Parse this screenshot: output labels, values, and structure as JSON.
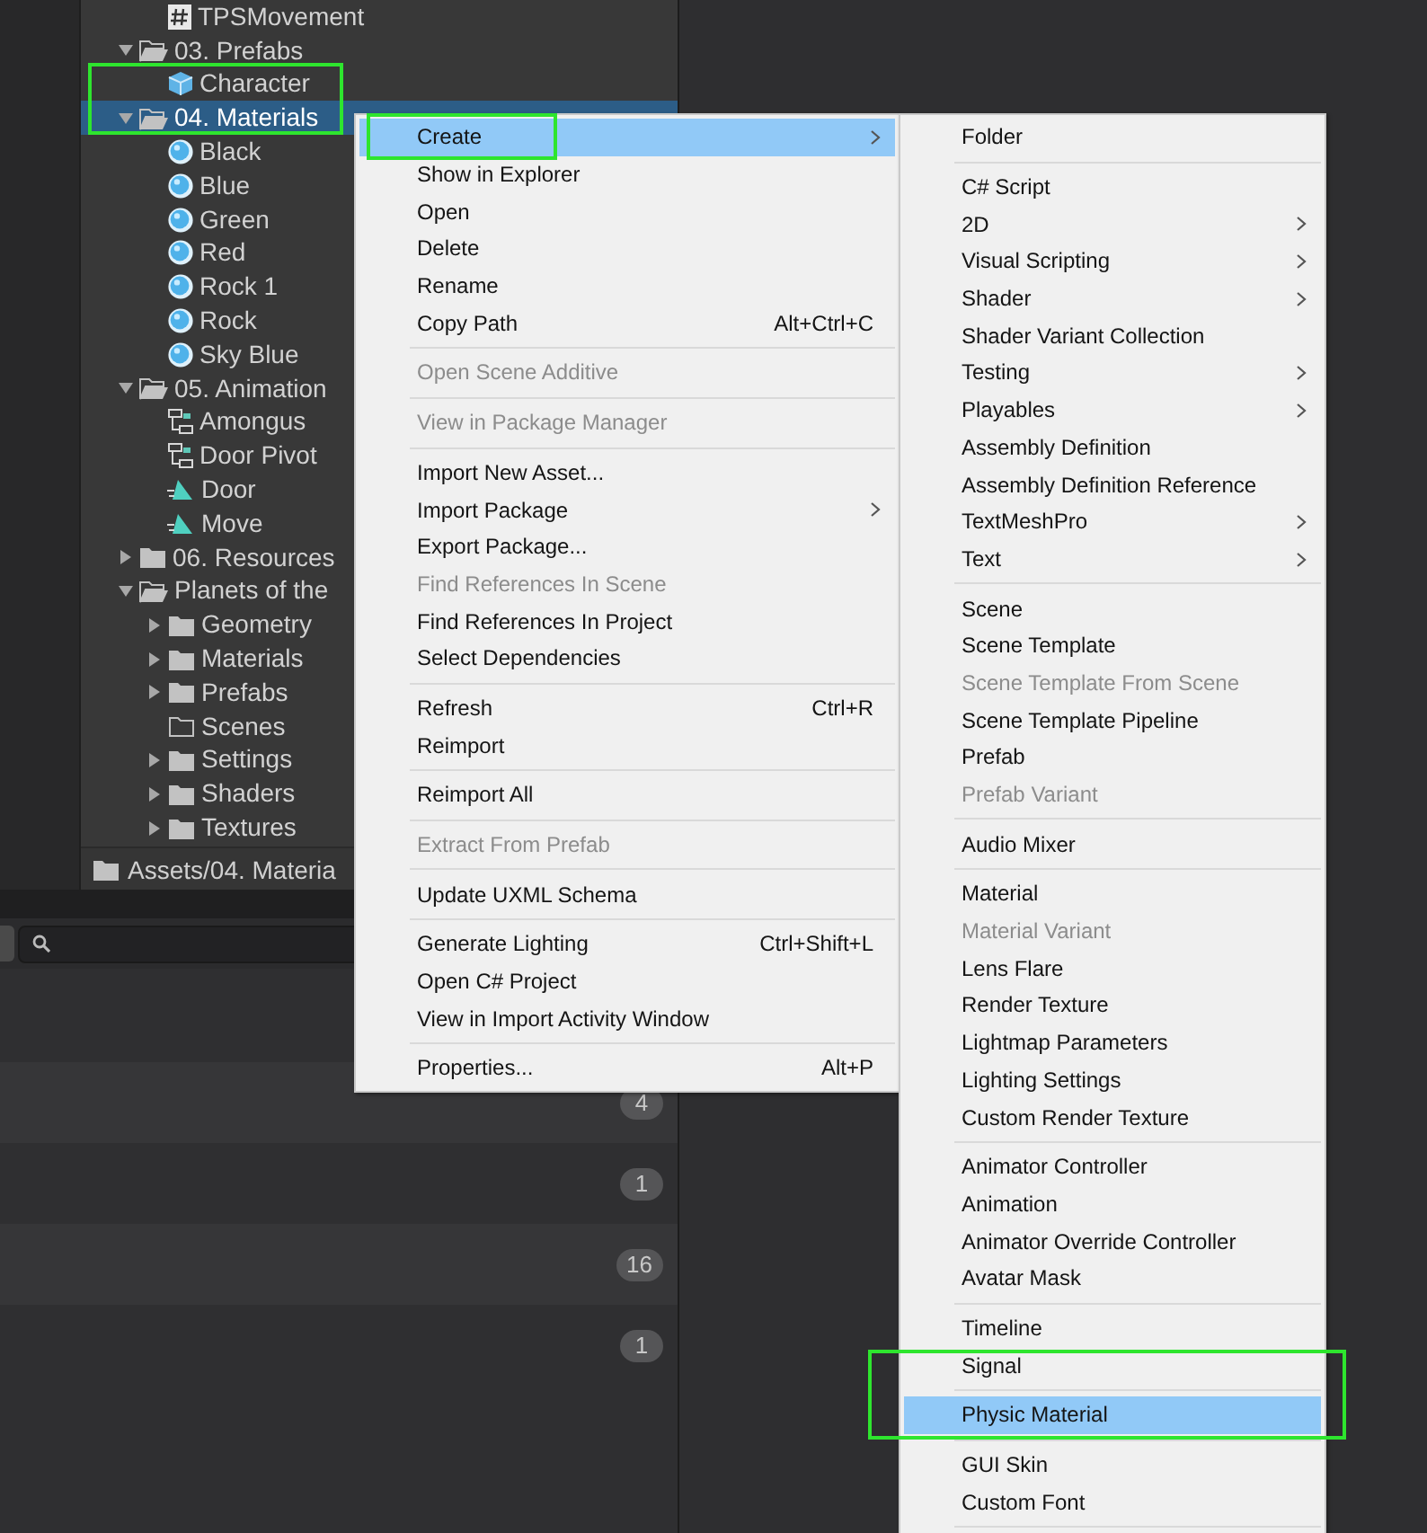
{
  "project_tree": {
    "continued": [
      {
        "label": "TPSMovement",
        "kind": "script",
        "selected": false
      }
    ],
    "items": [
      {
        "label": "03. Prefabs",
        "kind": "folder",
        "expanded": true,
        "selected": false,
        "children": [
          {
            "label": "Character",
            "kind": "prefab",
            "selected": false,
            "annotated": true
          }
        ]
      },
      {
        "label": "04. Materials",
        "kind": "folder",
        "expanded": true,
        "selected": true,
        "annotated": true,
        "children": [
          {
            "label": "Black",
            "kind": "material",
            "selected": false
          },
          {
            "label": "Blue",
            "kind": "material",
            "selected": false
          },
          {
            "label": "Green",
            "kind": "material",
            "selected": false
          },
          {
            "label": "Red",
            "kind": "material",
            "selected": false
          },
          {
            "label": "Rock 1",
            "kind": "material",
            "selected": false
          },
          {
            "label": "Rock",
            "kind": "material",
            "selected": false
          },
          {
            "label": "Sky Blue",
            "kind": "material",
            "selected": false
          }
        ]
      },
      {
        "label": "05. Animation",
        "kind": "folder",
        "expanded": true,
        "selected": false,
        "children": [
          {
            "label": "Amongus",
            "kind": "animator",
            "selected": false
          },
          {
            "label": "Door Pivot",
            "kind": "animator",
            "selected": false
          },
          {
            "label": "Door",
            "kind": "clip",
            "selected": false
          },
          {
            "label": "Move",
            "kind": "clip",
            "selected": false
          }
        ]
      },
      {
        "label": "06. Resources",
        "kind": "folder",
        "expanded": false,
        "selected": false
      },
      {
        "label": "Planets of the",
        "kind": "folder",
        "expanded": true,
        "selected": false,
        "children": [
          {
            "label": "Geometry",
            "kind": "folder",
            "expanded": false,
            "selected": false
          },
          {
            "label": "Materials",
            "kind": "folder",
            "expanded": false,
            "selected": false
          },
          {
            "label": "Prefabs",
            "kind": "folder",
            "expanded": false,
            "selected": false
          },
          {
            "label": "Scenes",
            "kind": "empty-folder",
            "selected": false
          },
          {
            "label": "Settings",
            "kind": "folder",
            "expanded": false,
            "selected": false
          },
          {
            "label": "Shaders",
            "kind": "folder",
            "expanded": false,
            "selected": false
          },
          {
            "label": "Textures",
            "kind": "folder",
            "expanded": false,
            "selected": false
          }
        ]
      }
    ]
  },
  "path_bar": {
    "path": "Assets/04. Materia"
  },
  "list": {
    "rows": [
      {
        "count": "4"
      },
      {
        "count": "1"
      },
      {
        "count": "16"
      },
      {
        "count": "1"
      }
    ]
  },
  "context_menu": {
    "items": [
      {
        "kind": "item",
        "label": "Create",
        "submenu": true,
        "disabled": false,
        "selected": true,
        "annotated": true
      },
      {
        "kind": "item",
        "label": "Show in Explorer",
        "disabled": false,
        "selected": false
      },
      {
        "kind": "item",
        "label": "Open",
        "disabled": false,
        "selected": false
      },
      {
        "kind": "item",
        "label": "Delete",
        "disabled": false,
        "selected": false
      },
      {
        "kind": "item",
        "label": "Rename",
        "disabled": false,
        "selected": false
      },
      {
        "kind": "item",
        "label": "Copy Path",
        "shortcut": "Alt+Ctrl+C",
        "disabled": false,
        "selected": false
      },
      {
        "kind": "separator"
      },
      {
        "kind": "item",
        "label": "Open Scene Additive",
        "disabled": true,
        "selected": false
      },
      {
        "kind": "separator"
      },
      {
        "kind": "item",
        "label": "View in Package Manager",
        "disabled": true,
        "selected": false
      },
      {
        "kind": "separator"
      },
      {
        "kind": "item",
        "label": "Import New Asset...",
        "disabled": false,
        "selected": false
      },
      {
        "kind": "item",
        "label": "Import Package",
        "submenu": true,
        "disabled": false,
        "selected": false
      },
      {
        "kind": "item",
        "label": "Export Package...",
        "disabled": false,
        "selected": false
      },
      {
        "kind": "item",
        "label": "Find References In Scene",
        "disabled": true,
        "selected": false
      },
      {
        "kind": "item",
        "label": "Find References In Project",
        "disabled": false,
        "selected": false
      },
      {
        "kind": "item",
        "label": "Select Dependencies",
        "disabled": false,
        "selected": false
      },
      {
        "kind": "separator"
      },
      {
        "kind": "item",
        "label": "Refresh",
        "shortcut": "Ctrl+R",
        "disabled": false,
        "selected": false
      },
      {
        "kind": "item",
        "label": "Reimport",
        "disabled": false,
        "selected": false
      },
      {
        "kind": "separator"
      },
      {
        "kind": "item",
        "label": "Reimport All",
        "disabled": false,
        "selected": false
      },
      {
        "kind": "separator"
      },
      {
        "kind": "item",
        "label": "Extract From Prefab",
        "disabled": true,
        "selected": false
      },
      {
        "kind": "separator"
      },
      {
        "kind": "item",
        "label": "Update UXML Schema",
        "disabled": false,
        "selected": false
      },
      {
        "kind": "separator"
      },
      {
        "kind": "item",
        "label": "Generate Lighting",
        "shortcut": "Ctrl+Shift+L",
        "disabled": false,
        "selected": false
      },
      {
        "kind": "item",
        "label": "Open C# Project",
        "disabled": false,
        "selected": false
      },
      {
        "kind": "item",
        "label": "View in Import Activity Window",
        "disabled": false,
        "selected": false
      },
      {
        "kind": "separator"
      },
      {
        "kind": "item",
        "label": "Properties...",
        "shortcut": "Alt+P",
        "disabled": false,
        "selected": false
      }
    ]
  },
  "create_submenu": {
    "items": [
      {
        "kind": "item",
        "label": "Folder",
        "disabled": false,
        "selected": false
      },
      {
        "kind": "separator"
      },
      {
        "kind": "item",
        "label": "C# Script",
        "disabled": false,
        "selected": false
      },
      {
        "kind": "item",
        "label": "2D",
        "submenu": true,
        "disabled": false,
        "selected": false
      },
      {
        "kind": "item",
        "label": "Visual Scripting",
        "submenu": true,
        "disabled": false,
        "selected": false
      },
      {
        "kind": "item",
        "label": "Shader",
        "submenu": true,
        "disabled": false,
        "selected": false
      },
      {
        "kind": "item",
        "label": "Shader Variant Collection",
        "disabled": false,
        "selected": false
      },
      {
        "kind": "item",
        "label": "Testing",
        "submenu": true,
        "disabled": false,
        "selected": false
      },
      {
        "kind": "item",
        "label": "Playables",
        "submenu": true,
        "disabled": false,
        "selected": false
      },
      {
        "kind": "item",
        "label": "Assembly Definition",
        "disabled": false,
        "selected": false
      },
      {
        "kind": "item",
        "label": "Assembly Definition Reference",
        "disabled": false,
        "selected": false
      },
      {
        "kind": "item",
        "label": "TextMeshPro",
        "submenu": true,
        "disabled": false,
        "selected": false
      },
      {
        "kind": "item",
        "label": "Text",
        "submenu": true,
        "disabled": false,
        "selected": false
      },
      {
        "kind": "separator"
      },
      {
        "kind": "item",
        "label": "Scene",
        "disabled": false,
        "selected": false
      },
      {
        "kind": "item",
        "label": "Scene Template",
        "disabled": false,
        "selected": false
      },
      {
        "kind": "item",
        "label": "Scene Template From Scene",
        "disabled": true,
        "selected": false
      },
      {
        "kind": "item",
        "label": "Scene Template Pipeline",
        "disabled": false,
        "selected": false
      },
      {
        "kind": "item",
        "label": "Prefab",
        "disabled": false,
        "selected": false
      },
      {
        "kind": "item",
        "label": "Prefab Variant",
        "disabled": true,
        "selected": false
      },
      {
        "kind": "separator"
      },
      {
        "kind": "item",
        "label": "Audio Mixer",
        "disabled": false,
        "selected": false
      },
      {
        "kind": "separator"
      },
      {
        "kind": "item",
        "label": "Material",
        "disabled": false,
        "selected": false
      },
      {
        "kind": "item",
        "label": "Material Variant",
        "disabled": true,
        "selected": false
      },
      {
        "kind": "item",
        "label": "Lens Flare",
        "disabled": false,
        "selected": false
      },
      {
        "kind": "item",
        "label": "Render Texture",
        "disabled": false,
        "selected": false
      },
      {
        "kind": "item",
        "label": "Lightmap Parameters",
        "disabled": false,
        "selected": false
      },
      {
        "kind": "item",
        "label": "Lighting Settings",
        "disabled": false,
        "selected": false
      },
      {
        "kind": "item",
        "label": "Custom Render Texture",
        "disabled": false,
        "selected": false
      },
      {
        "kind": "separator"
      },
      {
        "kind": "item",
        "label": "Animator Controller",
        "disabled": false,
        "selected": false
      },
      {
        "kind": "item",
        "label": "Animation",
        "disabled": false,
        "selected": false
      },
      {
        "kind": "item",
        "label": "Animator Override Controller",
        "disabled": false,
        "selected": false
      },
      {
        "kind": "item",
        "label": "Avatar Mask",
        "disabled": false,
        "selected": false
      },
      {
        "kind": "separator"
      },
      {
        "kind": "item",
        "label": "Timeline",
        "disabled": false,
        "selected": false
      },
      {
        "kind": "item",
        "label": "Signal",
        "disabled": false,
        "selected": false
      },
      {
        "kind": "separator"
      },
      {
        "kind": "item",
        "label": "Physic Material",
        "disabled": false,
        "selected": true,
        "annotated": true
      },
      {
        "kind": "separator"
      },
      {
        "kind": "item",
        "label": "GUI Skin",
        "disabled": false,
        "selected": false
      },
      {
        "kind": "item",
        "label": "Custom Font",
        "disabled": false,
        "selected": false
      },
      {
        "kind": "separator"
      }
    ]
  }
}
